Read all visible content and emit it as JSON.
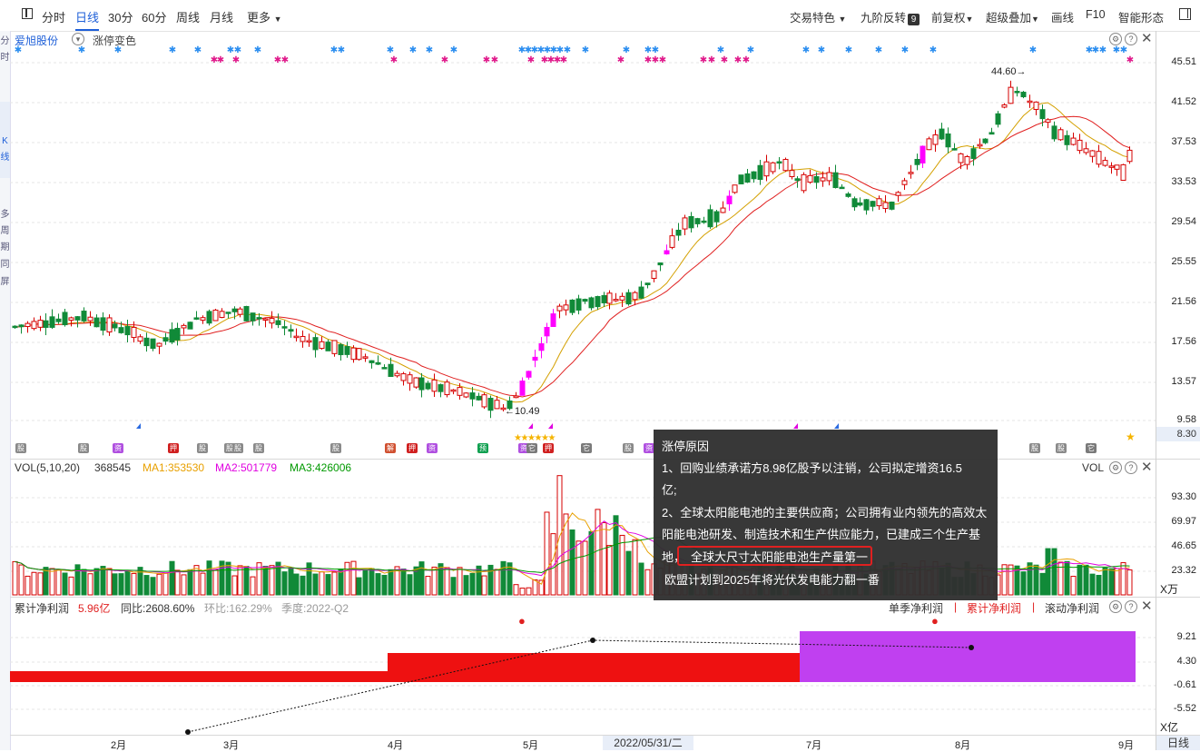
{
  "toolbar": {
    "tabs": [
      "分时",
      "日线",
      "30分",
      "60分",
      "周线",
      "月线",
      "更多"
    ],
    "active_tab": "日线",
    "right_tools": [
      "交易特色",
      "九阶反转",
      "前复权",
      "超级叠加",
      "画线",
      "F10",
      "智能形态"
    ],
    "badge_nine": "9"
  },
  "left_strip": [
    "分",
    "时",
    "K",
    "线",
    "多",
    "周",
    "期",
    "同",
    "屏"
  ],
  "stock": {
    "name": "爱旭股份",
    "option": "涨停变色"
  },
  "main_chart": {
    "y_ticks": [
      "45.51",
      "41.52",
      "37.53",
      "33.53",
      "29.54",
      "25.55",
      "21.56",
      "17.56",
      "13.57",
      "9.58"
    ],
    "current_price": "8.30",
    "high_label": "44.60",
    "low_label": "10.49",
    "ylim": [
      9.58,
      45.51
    ]
  },
  "volume": {
    "label": "VOL(5,10,20)",
    "value": "368545",
    "ma1": "MA1:353530",
    "ma2": "MA2:501779",
    "ma3": "MA3:426006",
    "title_right": "VOL",
    "y_ticks": [
      "93.30",
      "69.97",
      "46.65",
      "23.32"
    ],
    "unit": "X万",
    "colors": {
      "ma1": "#e8a000",
      "ma2": "#e000e0",
      "ma3": "#009900"
    }
  },
  "profit": {
    "label": "累计净利润",
    "value": "5.96亿",
    "yoy": "同比:2608.60%",
    "qoq": "环比:162.29%",
    "quarter": "季度:2022-Q2",
    "tabs": [
      "单季净利润",
      "累计净利润",
      "滚动净利润"
    ],
    "active_tab": "累计净利润",
    "y_ticks": [
      "9.21",
      "4.30",
      "-0.61",
      "-5.52"
    ],
    "unit": "X亿"
  },
  "x_axis": {
    "labels": [
      "2月",
      "3月",
      "4月",
      "5月",
      "7月",
      "8月",
      "9月"
    ],
    "cursor_date": "2022/05/31/二",
    "period": "日线"
  },
  "tooltip": {
    "title": "涨停原因",
    "lines": [
      "1、回购业绩承诺方8.98亿股予以注销，公司拟定增资16.5",
      "亿;",
      "2、全球太阳能电池的主要供应商；公司拥有业内领先的高效太",
      "阳能电池研发、制造技术和生产供应能力，已建成三个生产基",
      "地，",
      "欧盟计划到2025年将光伏发电能力翻一番"
    ],
    "highlight": "全球大尺寸太阳能电池生产量第一"
  },
  "events": [
    "股",
    "股",
    "资",
    "押",
    "股",
    "股",
    "股",
    "股",
    "股",
    "解",
    "押",
    "资",
    "预",
    "资",
    "它",
    "押",
    "它",
    "股",
    "资",
    "股",
    "股",
    "它"
  ],
  "colors": {
    "up": "#d60000",
    "down": "#108a38",
    "limit_up": "#ff00ff",
    "accent": "#1e5fd8",
    "ma_short": "#d4a000",
    "ma_long": "#e02020",
    "profit_bar1": "#ee1111",
    "profit_bar2": "#c040f0"
  }
}
